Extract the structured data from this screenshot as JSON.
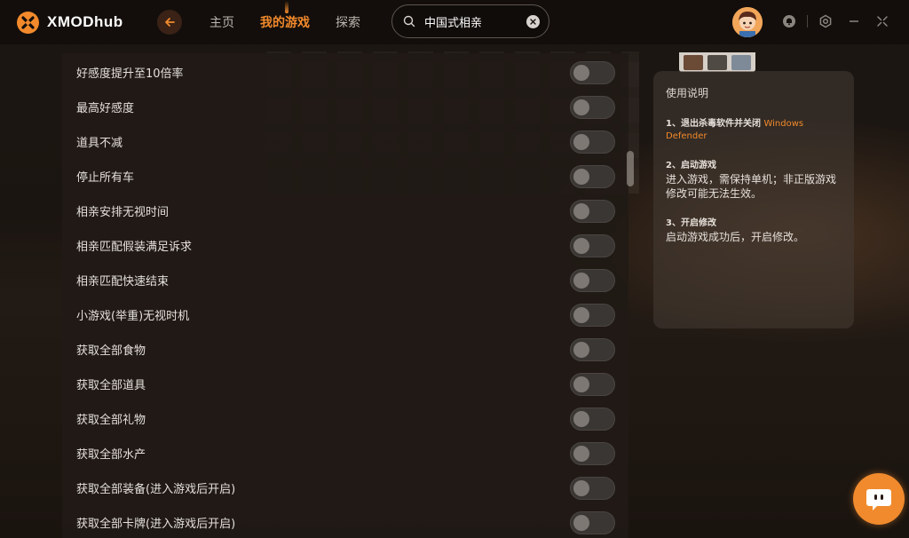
{
  "app": {
    "name": "XMODhub"
  },
  "nav": {
    "items": [
      {
        "label": "主页",
        "active": false
      },
      {
        "label": "我的游戏",
        "active": true
      },
      {
        "label": "探索",
        "active": false
      }
    ]
  },
  "search": {
    "value": "中国式相亲"
  },
  "icons": {
    "back": "arrow-left-icon",
    "search": "search-icon",
    "clear": "close-icon",
    "notifications": "bell-icon",
    "settings": "gear-icon",
    "minimize": "minimize-icon",
    "restore": "restore-icon",
    "chat": "chat-icon"
  },
  "colors": {
    "accent": "#f28a2c",
    "background": "#17110d",
    "panel": "#201a16"
  },
  "cheats": [
    {
      "label": "好感度提升至10倍率",
      "enabled": false
    },
    {
      "label": "最高好感度",
      "enabled": false
    },
    {
      "label": "道具不减",
      "enabled": false
    },
    {
      "label": "停止所有车",
      "enabled": false
    },
    {
      "label": "相亲安排无视时间",
      "enabled": false
    },
    {
      "label": "相亲匹配假装满足诉求",
      "enabled": false
    },
    {
      "label": "相亲匹配快速结束",
      "enabled": false
    },
    {
      "label": "小游戏(举重)无视时机",
      "enabled": false
    },
    {
      "label": "获取全部食物",
      "enabled": false
    },
    {
      "label": "获取全部道具",
      "enabled": false
    },
    {
      "label": "获取全部礼物",
      "enabled": false
    },
    {
      "label": "获取全部水产",
      "enabled": false
    },
    {
      "label": "获取全部装备(进入游戏后开启)",
      "enabled": false
    },
    {
      "label": "获取全部卡牌(进入游戏后开启)",
      "enabled": false
    }
  ],
  "instructions": {
    "title": "使用说明",
    "steps": [
      {
        "title": "1、退出杀毒软件并关闭 ",
        "highlight": "Windows Defender",
        "desc": ""
      },
      {
        "title": "2、启动游戏",
        "highlight": "",
        "desc": "进入游戏，需保持单机；非正版游戏修改可能无法生效。"
      },
      {
        "title": "3、开启修改",
        "highlight": "",
        "desc": "启动游戏成功后，开启修改。"
      }
    ]
  }
}
